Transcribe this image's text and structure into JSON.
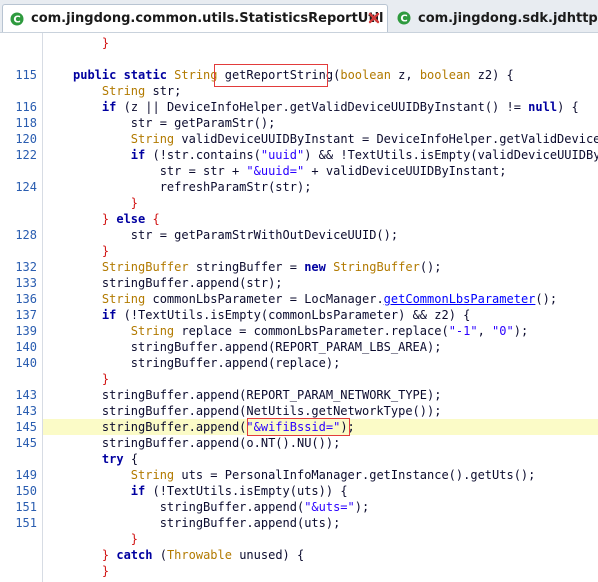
{
  "tabs": [
    {
      "label": "com.jingdong.common.utils.StatisticsReportUtil",
      "active": true,
      "icon": "java-class-icon"
    },
    {
      "label": "com.jingdong.sdk.jdhttpdns",
      "active": false,
      "icon": "java-class-icon"
    }
  ],
  "colors": {
    "keyword": "#0000a0",
    "type": "#b27a00",
    "string": "#2a00ff",
    "highlight": "#fbfbc7",
    "box": "#e23b3b",
    "linenum": "#2a5db0"
  },
  "lines": [
    {
      "n": "",
      "segs": [
        [
          "    ",
          ""
        ],
        [
          "}",
          "br"
        ]
      ]
    },
    {
      "n": "",
      "segs": []
    },
    {
      "n": "115",
      "segs": [
        [
          "public static ",
          "kw"
        ],
        [
          "String ",
          "ty"
        ],
        [
          "getReportString",
          ""
        ],
        [
          "(",
          ""
        ],
        [
          "boolean ",
          "ty"
        ],
        [
          "z, ",
          ""
        ],
        [
          "boolean ",
          "ty"
        ],
        [
          "z2) {",
          ""
        ]
      ]
    },
    {
      "n": "",
      "segs": [
        [
          "    ",
          ""
        ],
        [
          "String ",
          "ty"
        ],
        [
          "str;",
          ""
        ]
      ]
    },
    {
      "n": "116",
      "segs": [
        [
          "    ",
          ""
        ],
        [
          "if ",
          "kw"
        ],
        [
          "(z || DeviceInfoHelper.getValidDeviceUUIDByInstant() != ",
          ""
        ],
        [
          "null",
          "kw"
        ],
        [
          ") {",
          ""
        ]
      ]
    },
    {
      "n": "118",
      "segs": [
        [
          "        str = getParamStr();",
          ""
        ]
      ]
    },
    {
      "n": "120",
      "segs": [
        [
          "        ",
          ""
        ],
        [
          "String ",
          "ty"
        ],
        [
          "validDeviceUUIDByInstant = DeviceInfoHelper.getValidDeviceUUI",
          ""
        ]
      ]
    },
    {
      "n": "122",
      "segs": [
        [
          "        ",
          ""
        ],
        [
          "if ",
          "kw"
        ],
        [
          "(!str.contains(",
          ""
        ],
        [
          "\"uuid\"",
          "str"
        ],
        [
          ") && !TextUtils.isEmpty(validDeviceUUIDByIn",
          ""
        ]
      ]
    },
    {
      "n": "",
      "segs": [
        [
          "            str = str + ",
          ""
        ],
        [
          "\"&uuid=\"",
          "str"
        ],
        [
          " + validDeviceUUIDByInstant;",
          ""
        ]
      ]
    },
    {
      "n": "124",
      "segs": [
        [
          "            refreshParamStr(str);",
          ""
        ]
      ]
    },
    {
      "n": "",
      "segs": [
        [
          "        ",
          ""
        ],
        [
          "}",
          "br"
        ]
      ]
    },
    {
      "n": "",
      "segs": [
        [
          "    ",
          ""
        ],
        [
          "} ",
          "br"
        ],
        [
          "else ",
          "kw"
        ],
        [
          "{",
          "br"
        ]
      ]
    },
    {
      "n": "128",
      "segs": [
        [
          "        str = getParamStrWithOutDeviceUUID();",
          ""
        ]
      ]
    },
    {
      "n": "",
      "segs": [
        [
          "    ",
          ""
        ],
        [
          "}",
          "br"
        ]
      ]
    },
    {
      "n": "132",
      "segs": [
        [
          "    ",
          ""
        ],
        [
          "StringBuffer ",
          "ty"
        ],
        [
          "stringBuffer = ",
          ""
        ],
        [
          "new ",
          "kw"
        ],
        [
          "StringBuffer",
          "ty"
        ],
        [
          "();",
          ""
        ]
      ]
    },
    {
      "n": "133",
      "segs": [
        [
          "    stringBuffer.append(str);",
          ""
        ]
      ]
    },
    {
      "n": "136",
      "segs": [
        [
          "    ",
          ""
        ],
        [
          "String ",
          "ty"
        ],
        [
          "commonLbsParameter = LocManager.",
          ""
        ],
        [
          "getCommonLbsParameter",
          "lnk"
        ],
        [
          "();",
          ""
        ]
      ]
    },
    {
      "n": "137",
      "segs": [
        [
          "    ",
          ""
        ],
        [
          "if ",
          "kw"
        ],
        [
          "(!TextUtils.isEmpty(commonLbsParameter) && z2) {",
          ""
        ]
      ]
    },
    {
      "n": "139",
      "segs": [
        [
          "        ",
          ""
        ],
        [
          "String ",
          "ty"
        ],
        [
          "replace = commonLbsParameter.replace(",
          ""
        ],
        [
          "\"-1\"",
          "str"
        ],
        [
          ", ",
          ""
        ],
        [
          "\"0\"",
          "str"
        ],
        [
          ");",
          ""
        ]
      ]
    },
    {
      "n": "140",
      "segs": [
        [
          "        stringBuffer.append(REPORT_PARAM_LBS_AREA);",
          ""
        ]
      ]
    },
    {
      "n": "140",
      "segs": [
        [
          "        stringBuffer.append(replace);",
          ""
        ]
      ]
    },
    {
      "n": "",
      "segs": [
        [
          "    ",
          ""
        ],
        [
          "}",
          "br"
        ]
      ]
    },
    {
      "n": "143",
      "segs": [
        [
          "    stringBuffer.append(REPORT_PARAM_NETWORK_TYPE);",
          ""
        ]
      ]
    },
    {
      "n": "143",
      "segs": [
        [
          "    stringBuffer.append(NetUtils.getNetworkType());",
          ""
        ]
      ]
    },
    {
      "n": "145",
      "hl": true,
      "segs": [
        [
          "    stringBuffer.append(",
          ""
        ],
        [
          "\"&wifiBssid=\"",
          "str"
        ],
        [
          ");",
          ""
        ]
      ]
    },
    {
      "n": "145",
      "segs": [
        [
          "    stringBuffer.append(o.NT().NU());",
          ""
        ]
      ]
    },
    {
      "n": "",
      "segs": [
        [
          "    ",
          ""
        ],
        [
          "try ",
          "kw"
        ],
        [
          "{",
          ""
        ]
      ]
    },
    {
      "n": "149",
      "segs": [
        [
          "        ",
          ""
        ],
        [
          "String ",
          "ty"
        ],
        [
          "uts = PersonalInfoManager.getInstance().getUts();",
          ""
        ]
      ]
    },
    {
      "n": "150",
      "segs": [
        [
          "        ",
          ""
        ],
        [
          "if ",
          "kw"
        ],
        [
          "(!TextUtils.isEmpty(uts)) {",
          ""
        ]
      ]
    },
    {
      "n": "151",
      "segs": [
        [
          "            stringBuffer.append(",
          ""
        ],
        [
          "\"&uts=\"",
          "str"
        ],
        [
          ");",
          ""
        ]
      ]
    },
    {
      "n": "151",
      "segs": [
        [
          "            stringBuffer.append(uts);",
          ""
        ]
      ]
    },
    {
      "n": "",
      "segs": [
        [
          "        ",
          ""
        ],
        [
          "}",
          "br"
        ]
      ]
    },
    {
      "n": "",
      "segs": [
        [
          "    ",
          ""
        ],
        [
          "} ",
          "br"
        ],
        [
          "catch ",
          "kw"
        ],
        [
          "(",
          ""
        ],
        [
          "Throwable ",
          "ty"
        ],
        [
          "unused) {",
          ""
        ]
      ]
    },
    {
      "n": "",
      "segs": [
        [
          "    ",
          ""
        ],
        [
          "}",
          "br"
        ]
      ]
    }
  ]
}
